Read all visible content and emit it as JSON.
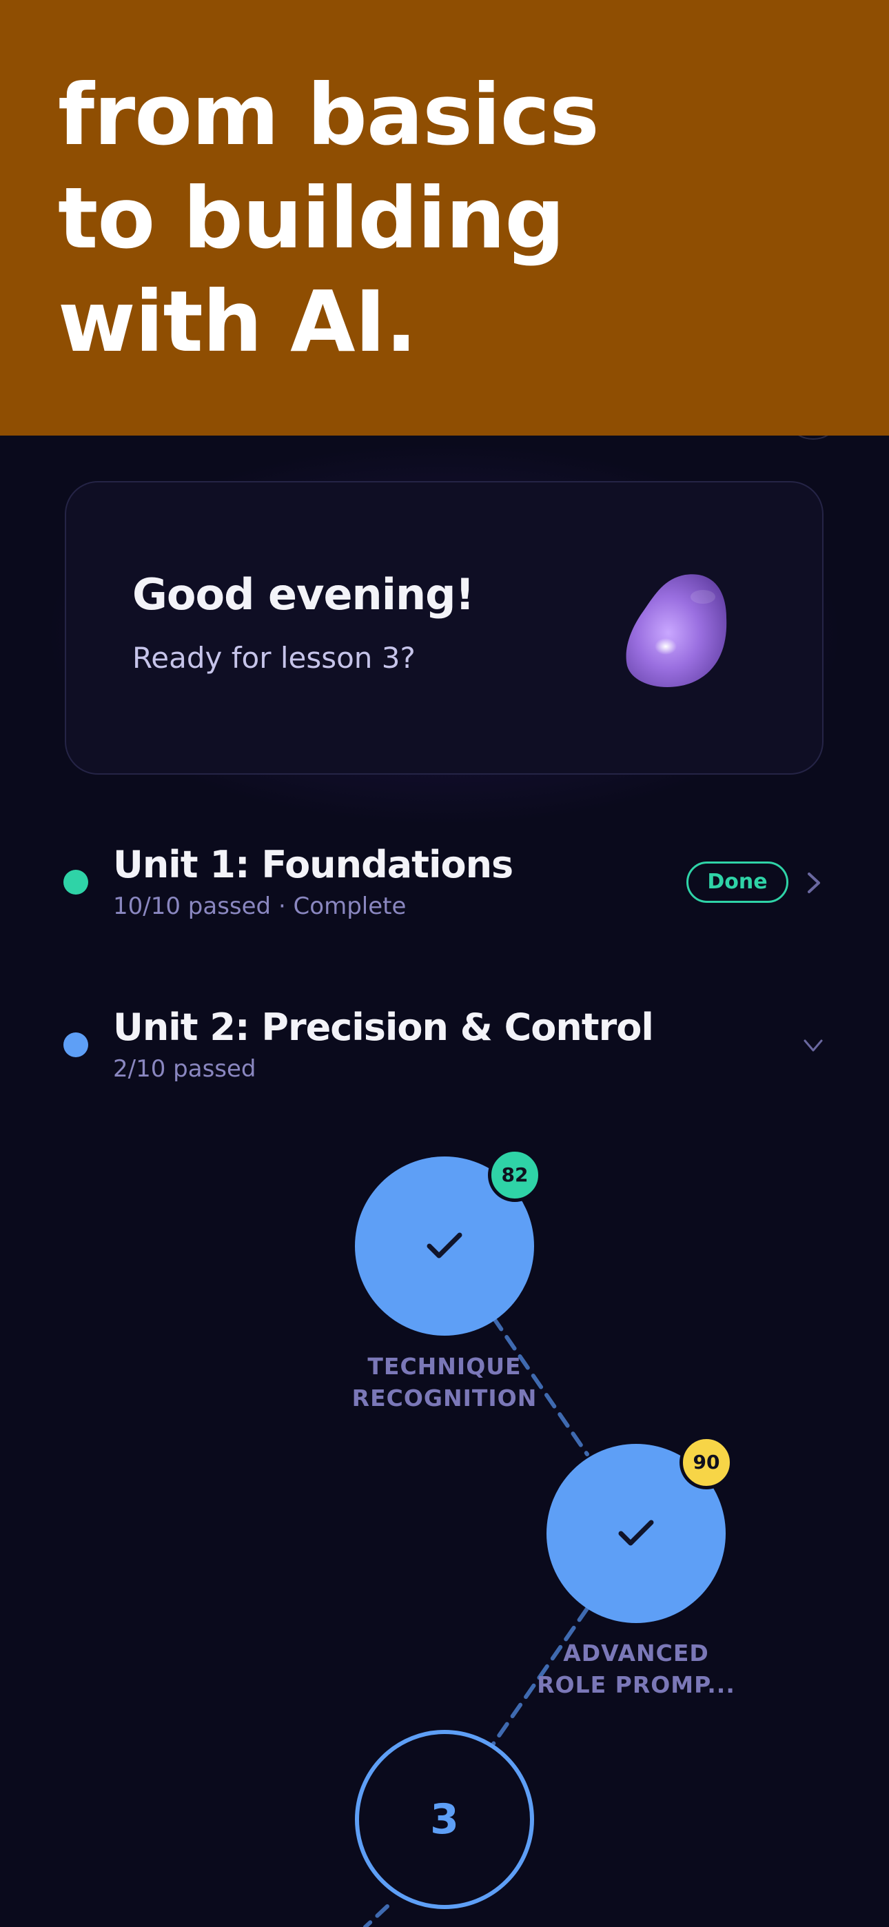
{
  "hero": {
    "lines": [
      "from basics",
      "to building",
      "with AI."
    ]
  },
  "greeting": {
    "title": "Good evening!",
    "subtitle": "Ready for lesson 3?",
    "mascot_icon": "purple-blob-mascot"
  },
  "units": [
    {
      "title": "Unit 1: Foundations",
      "subtitle": "10/10 passed · Complete",
      "badge": "Done",
      "dot_color": "#2fd3a7",
      "state": "collapsed"
    },
    {
      "title": "Unit 2: Precision & Control",
      "subtitle": "2/10 passed",
      "dot_color": "#5e9ff6",
      "state": "expanded"
    }
  ],
  "lessons": [
    {
      "label_lines": [
        "TECHNIQUE",
        "RECOGNITION"
      ],
      "score": "82",
      "score_color": "#2fd3a7",
      "status": "completed",
      "icon": "check-icon"
    },
    {
      "label_lines": [
        "ADVANCED",
        "ROLE PROMP..."
      ],
      "score": "90",
      "score_color": "#f7d547",
      "status": "completed",
      "icon": "check-icon"
    },
    {
      "number": "3",
      "status": "current"
    }
  ],
  "colors": {
    "background": "#0a0a1c",
    "hero_background": "#8f4e02",
    "accent_blue": "#5e9ff6",
    "accent_green": "#2fd3a7",
    "accent_yellow": "#f7d547"
  }
}
